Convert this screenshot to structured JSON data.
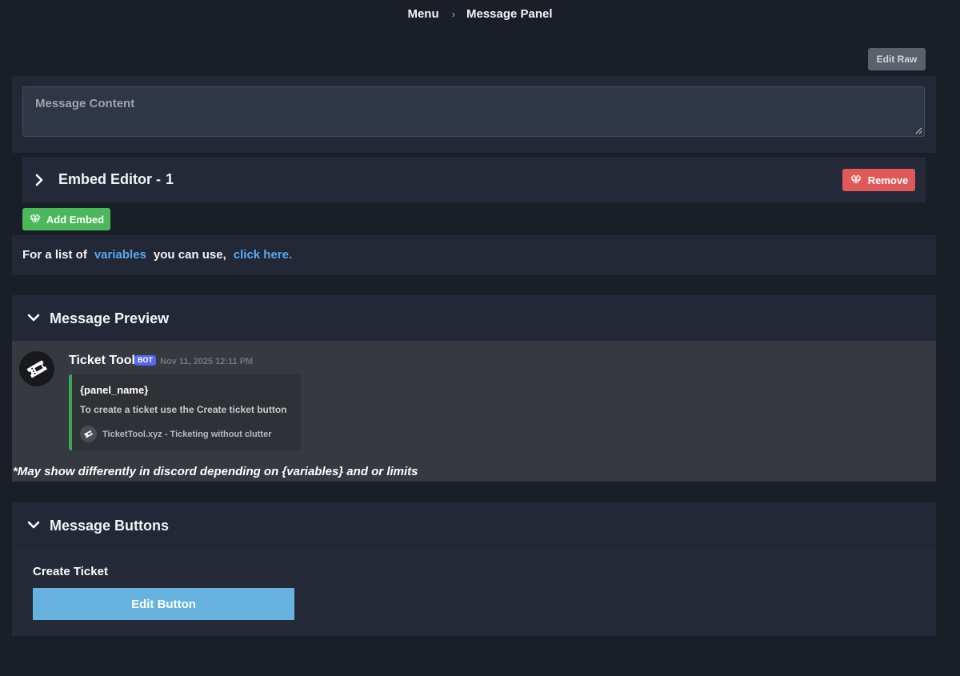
{
  "breadcrumb": {
    "items": [
      "Menu",
      "Message Panel"
    ],
    "separator": "›"
  },
  "toolbar": {
    "edit_raw_label": "Edit Raw"
  },
  "message_content": {
    "placeholder": "Message Content"
  },
  "embed_editor": {
    "title": "Embed Editor -",
    "index": "1",
    "remove_label": "Remove",
    "remove_color": "#e05858"
  },
  "add_embed": {
    "label": "Add Embed",
    "color": "#4cb85c"
  },
  "variables_info": {
    "prefix": "For a list of",
    "link1": "variables",
    "middle": "you can use,",
    "link2": "click here."
  },
  "preview": {
    "section_title": "Message Preview",
    "bot_name": "Ticket Tool",
    "bot_tag": "BOT",
    "timestamp": "Nov 11, 2025 12:11 PM",
    "embed": {
      "title": "{panel_name}",
      "description": "To create a ticket use the Create ticket button",
      "footer": "TicketTool.xyz - Ticketing without clutter",
      "accent_color": "#3ba55c"
    },
    "disclaimer": "*May show differently in discord depending on {variables} and or limits"
  },
  "message_buttons": {
    "section_title": "Message Buttons",
    "button_name": "Create Ticket",
    "edit_label": "Edit Button",
    "edit_color": "#66b3e0"
  },
  "icons": [
    "chevron-right-icon",
    "chevron-down-icon",
    "gem-icon",
    "ticket-icon",
    "resize-icon"
  ]
}
